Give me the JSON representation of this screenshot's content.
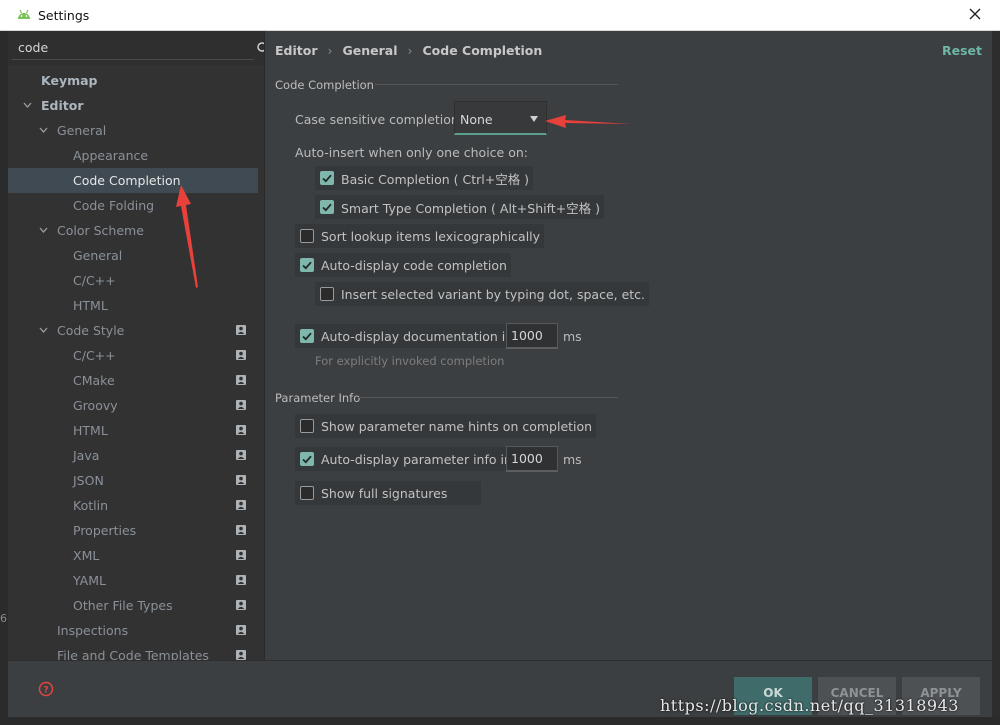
{
  "window": {
    "title": "Settings"
  },
  "search": {
    "value": "code"
  },
  "sidebar": {
    "items": [
      {
        "label": "Keymap",
        "level": 0,
        "style": "bold"
      },
      {
        "label": "Editor",
        "level": 0,
        "style": "bold",
        "expanded": true
      },
      {
        "label": "General",
        "level": 1,
        "style": "dim",
        "expanded": true
      },
      {
        "label": "Appearance",
        "level": 2,
        "style": "dim"
      },
      {
        "label": "Code Completion",
        "level": 2,
        "style": "selected"
      },
      {
        "label": "Code Folding",
        "level": 2,
        "style": "dim"
      },
      {
        "label": "Color Scheme",
        "level": 1,
        "style": "dim",
        "expanded": true
      },
      {
        "label": "General",
        "level": 2,
        "style": "dim"
      },
      {
        "label": "C/C++",
        "level": 2,
        "style": "dim"
      },
      {
        "label": "HTML",
        "level": 2,
        "style": "dim"
      },
      {
        "label": "Code Style",
        "level": 1,
        "style": "dim",
        "expanded": true,
        "project": true
      },
      {
        "label": "C/C++",
        "level": 2,
        "style": "dim",
        "project": true
      },
      {
        "label": "CMake",
        "level": 2,
        "style": "dim",
        "project": true
      },
      {
        "label": "Groovy",
        "level": 2,
        "style": "dim",
        "project": true
      },
      {
        "label": "HTML",
        "level": 2,
        "style": "dim",
        "project": true
      },
      {
        "label": "Java",
        "level": 2,
        "style": "dim",
        "project": true
      },
      {
        "label": "JSON",
        "level": 2,
        "style": "dim",
        "project": true
      },
      {
        "label": "Kotlin",
        "level": 2,
        "style": "dim",
        "project": true
      },
      {
        "label": "Properties",
        "level": 2,
        "style": "dim",
        "project": true
      },
      {
        "label": "XML",
        "level": 2,
        "style": "dim",
        "project": true
      },
      {
        "label": "YAML",
        "level": 2,
        "style": "dim",
        "project": true
      },
      {
        "label": "Other File Types",
        "level": 2,
        "style": "dim",
        "project": true
      },
      {
        "label": "Inspections",
        "level": 1,
        "style": "dim",
        "project": true
      },
      {
        "label": "File and Code Templates",
        "level": 1,
        "style": "dim",
        "project": true
      }
    ]
  },
  "breadcrumb": {
    "part1": "Editor",
    "part2": "General",
    "part3": "Code Completion"
  },
  "reset_label": "Reset",
  "code_completion": {
    "section_title": "Code Completion",
    "case_sensitive_label": "Case sensitive completion:",
    "case_sensitive_value": "None",
    "auto_insert_label": "Auto-insert when only one choice on:",
    "basic_completion": "Basic Completion ( Ctrl+空格 )",
    "smart_type_completion": "Smart Type Completion ( Alt+Shift+空格 )",
    "sort_lookup": "Sort lookup items lexicographically",
    "auto_display_completion": "Auto-display code completion",
    "insert_selected_variant": "Insert selected variant by typing dot, space, etc.",
    "auto_display_documentation": "Auto-display documentation in",
    "documentation_delay": "1000",
    "ms_label": "ms",
    "explicit_hint": "For explicitly invoked completion"
  },
  "parameter_info": {
    "section_title": "Parameter Info",
    "show_name_hints": "Show parameter name hints on completion",
    "auto_display_param_info": "Auto-display parameter info in",
    "param_delay": "1000",
    "ms_label": "ms",
    "show_full_signatures": "Show full signatures"
  },
  "checkbox_states": {
    "basic_completion": true,
    "smart_type_completion": true,
    "sort_lookup": false,
    "auto_display_completion": true,
    "insert_selected_variant": false,
    "auto_display_documentation": true,
    "show_name_hints": false,
    "auto_display_param_info": true,
    "show_full_signatures": false
  },
  "footer": {
    "ok_label": "OK",
    "cancel_label": "CANCEL",
    "apply_label": "APPLY"
  },
  "watermark": "https://blog.csdn.net/qq_31318943",
  "outer_edge_char": "6",
  "colors": {
    "accent": "#5aa08f",
    "checkbox_on": "#7fb7ad",
    "selection": "#3f4a52",
    "annotation_arrow": "#e8403a"
  }
}
